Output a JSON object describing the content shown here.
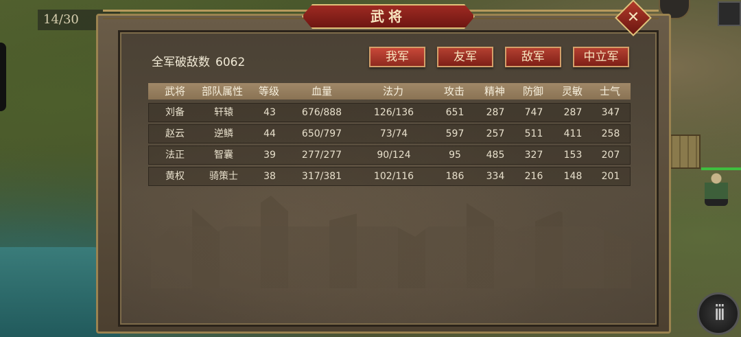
{
  "hud": {
    "counter": "14/30",
    "menu_icon": "iii"
  },
  "panel": {
    "title": "武将",
    "close_icon": "✕",
    "kills_label": "全军破敌数",
    "kills_value": "6062",
    "tabs": [
      "我军",
      "友军",
      "敌军",
      "中立军"
    ]
  },
  "table": {
    "headers": [
      "武将",
      "部队属性",
      "等级",
      "血量",
      "法力",
      "攻击",
      "精神",
      "防御",
      "灵敏",
      "士气"
    ],
    "rows": [
      [
        "刘备",
        "轩辕",
        "43",
        "676/888",
        "126/136",
        "651",
        "287",
        "747",
        "287",
        "347"
      ],
      [
        "赵云",
        "逆鳞",
        "44",
        "650/797",
        "73/74",
        "597",
        "257",
        "511",
        "411",
        "258"
      ],
      [
        "法正",
        "智囊",
        "39",
        "277/277",
        "90/124",
        "95",
        "485",
        "327",
        "153",
        "207"
      ],
      [
        "黄权",
        "骑策士",
        "38",
        "317/381",
        "102/116",
        "186",
        "334",
        "216",
        "148",
        "201"
      ]
    ]
  }
}
